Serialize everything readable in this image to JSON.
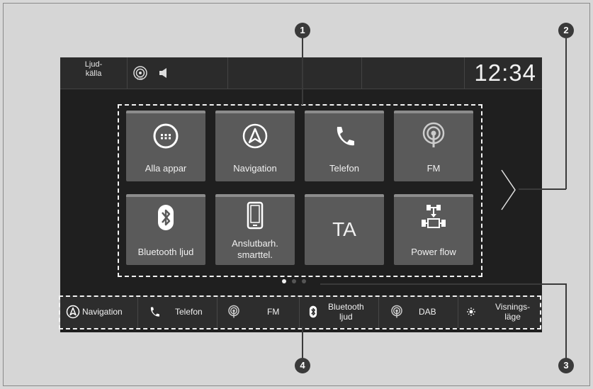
{
  "topbar": {
    "source_line1": "Ljud-",
    "source_line2": "källa",
    "clock": "12:34"
  },
  "apps": [
    {
      "label": "Alla appar",
      "icon": "grid-circle-icon"
    },
    {
      "label": "Navigation",
      "icon": "navigation-arrow-icon"
    },
    {
      "label": "Telefon",
      "icon": "phone-icon"
    },
    {
      "label": "FM",
      "icon": "radio-antenna-icon"
    },
    {
      "label": "Bluetooth ljud",
      "icon": "bluetooth-icon"
    },
    {
      "label_line1": "Anslutbarh.",
      "label_line2": "smarttel.",
      "icon": "smartphone-icon"
    },
    {
      "label": "TA",
      "icon": "none"
    },
    {
      "label": "Power flow",
      "icon": "power-flow-icon"
    }
  ],
  "page_indicator": {
    "pages": 3,
    "active": 1
  },
  "shortcuts": [
    {
      "label": "Navigation",
      "icon": "navigation-arrow-icon"
    },
    {
      "label": "Telefon",
      "icon": "phone-icon"
    },
    {
      "label": "FM",
      "icon": "radio-antenna-icon"
    },
    {
      "label_line1": "Bluetooth",
      "label_line2": "ljud",
      "icon": "bluetooth-icon"
    },
    {
      "label": "DAB",
      "icon": "radio-antenna-icon"
    },
    {
      "label_line1": "Visnings-",
      "label_line2": "läge",
      "icon": "day-night-icon"
    }
  ],
  "callouts": [
    "1",
    "2",
    "3",
    "4"
  ],
  "colors": {
    "screen_bg": "#1f1f1f",
    "tile_bg": "#5a5a5a",
    "callout": "#3a3a3a"
  }
}
